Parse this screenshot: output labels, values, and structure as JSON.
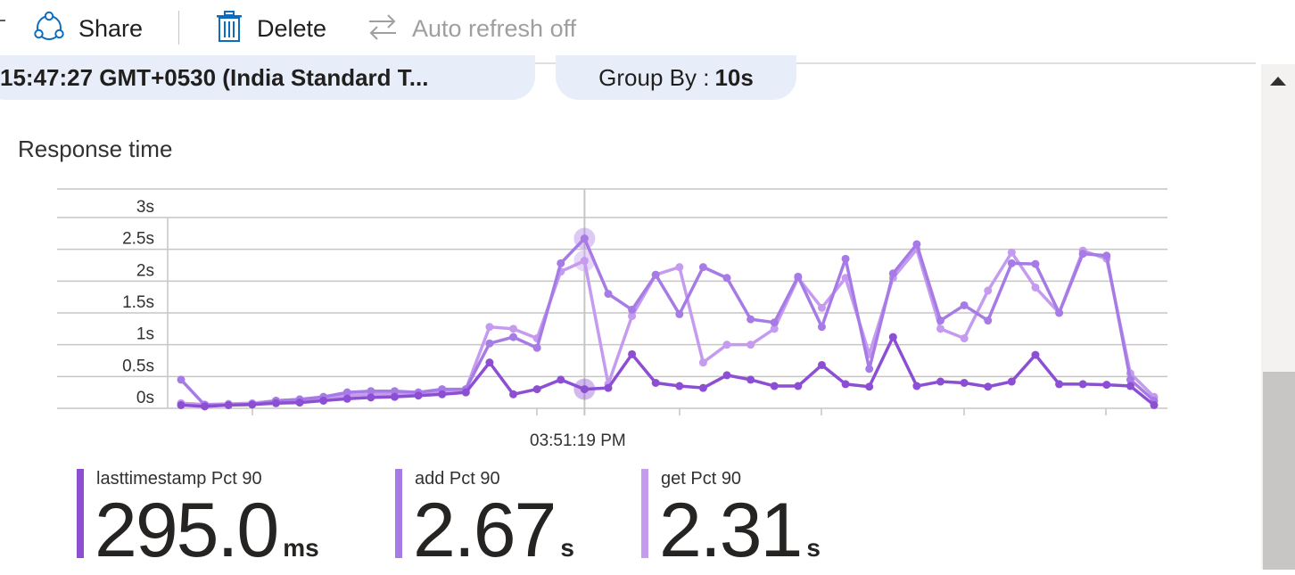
{
  "toolbar": {
    "share_label": "Share",
    "delete_label": "Delete",
    "auto_refresh_label": "Auto refresh off"
  },
  "filters": {
    "time_range": "15:47:27 GMT+0530 (India Standard T...",
    "group_by_label": "Group By :",
    "group_by_value": "10s"
  },
  "chart": {
    "title": "Response time",
    "hover_time": "03:51:19 PM"
  },
  "colors": {
    "lasttimestamp": "#8c4fd3",
    "add": "#a77be6",
    "get": "#c59bf0",
    "scroll_thumb": "#c8c6c4"
  },
  "legend": [
    {
      "name": "lasttimestamp Pct 90",
      "value": "295.0",
      "unit": "ms"
    },
    {
      "name": "add Pct 90",
      "value": "2.67",
      "unit": "s"
    },
    {
      "name": "get Pct 90",
      "value": "2.31",
      "unit": "s"
    }
  ],
  "chart_data": {
    "type": "line",
    "title": "Response time",
    "ylabel": "",
    "xlabel": "",
    "ylim": [
      0,
      3
    ],
    "yticks": [
      "0s",
      "0.5s",
      "1s",
      "1.5s",
      "2s",
      "2.5s",
      "3s"
    ],
    "x_highlight_label": "03:51:19 PM",
    "grid": true,
    "series": [
      {
        "name": "lasttimestamp Pct 90",
        "values": [
          0.05,
          0.03,
          0.05,
          0.06,
          0.08,
          0.09,
          0.12,
          0.15,
          0.17,
          0.18,
          0.2,
          0.22,
          0.25,
          0.72,
          0.22,
          0.3,
          0.45,
          0.3,
          0.32,
          0.85,
          0.4,
          0.35,
          0.32,
          0.52,
          0.45,
          0.35,
          0.35,
          0.68,
          0.38,
          0.34,
          1.12,
          0.35,
          0.42,
          0.4,
          0.34,
          0.42,
          0.84,
          0.38,
          0.38,
          0.37,
          0.35,
          0.05
        ]
      },
      {
        "name": "add Pct 90",
        "values": [
          0.45,
          0.05,
          0.05,
          0.06,
          0.12,
          0.14,
          0.18,
          0.25,
          0.27,
          0.27,
          0.25,
          0.3,
          0.3,
          1.02,
          1.12,
          0.95,
          2.28,
          2.67,
          1.8,
          1.55,
          2.1,
          1.48,
          2.22,
          2.05,
          1.4,
          1.35,
          2.07,
          1.28,
          2.35,
          0.62,
          2.12,
          2.58,
          1.38,
          1.62,
          1.38,
          2.28,
          2.27,
          1.5,
          2.43,
          2.4,
          0.45,
          0.12
        ]
      },
      {
        "name": "get Pct 90",
        "values": [
          0.08,
          0.06,
          0.07,
          0.08,
          0.12,
          0.14,
          0.16,
          0.2,
          0.22,
          0.22,
          0.24,
          0.27,
          0.3,
          1.28,
          1.25,
          1.1,
          2.15,
          2.32,
          0.38,
          1.45,
          2.1,
          2.22,
          0.72,
          1.0,
          1.0,
          1.25,
          2.05,
          1.58,
          2.05,
          0.85,
          2.05,
          2.5,
          1.25,
          1.1,
          1.85,
          2.45,
          1.9,
          1.5,
          2.48,
          2.35,
          0.55,
          0.18
        ]
      }
    ]
  }
}
